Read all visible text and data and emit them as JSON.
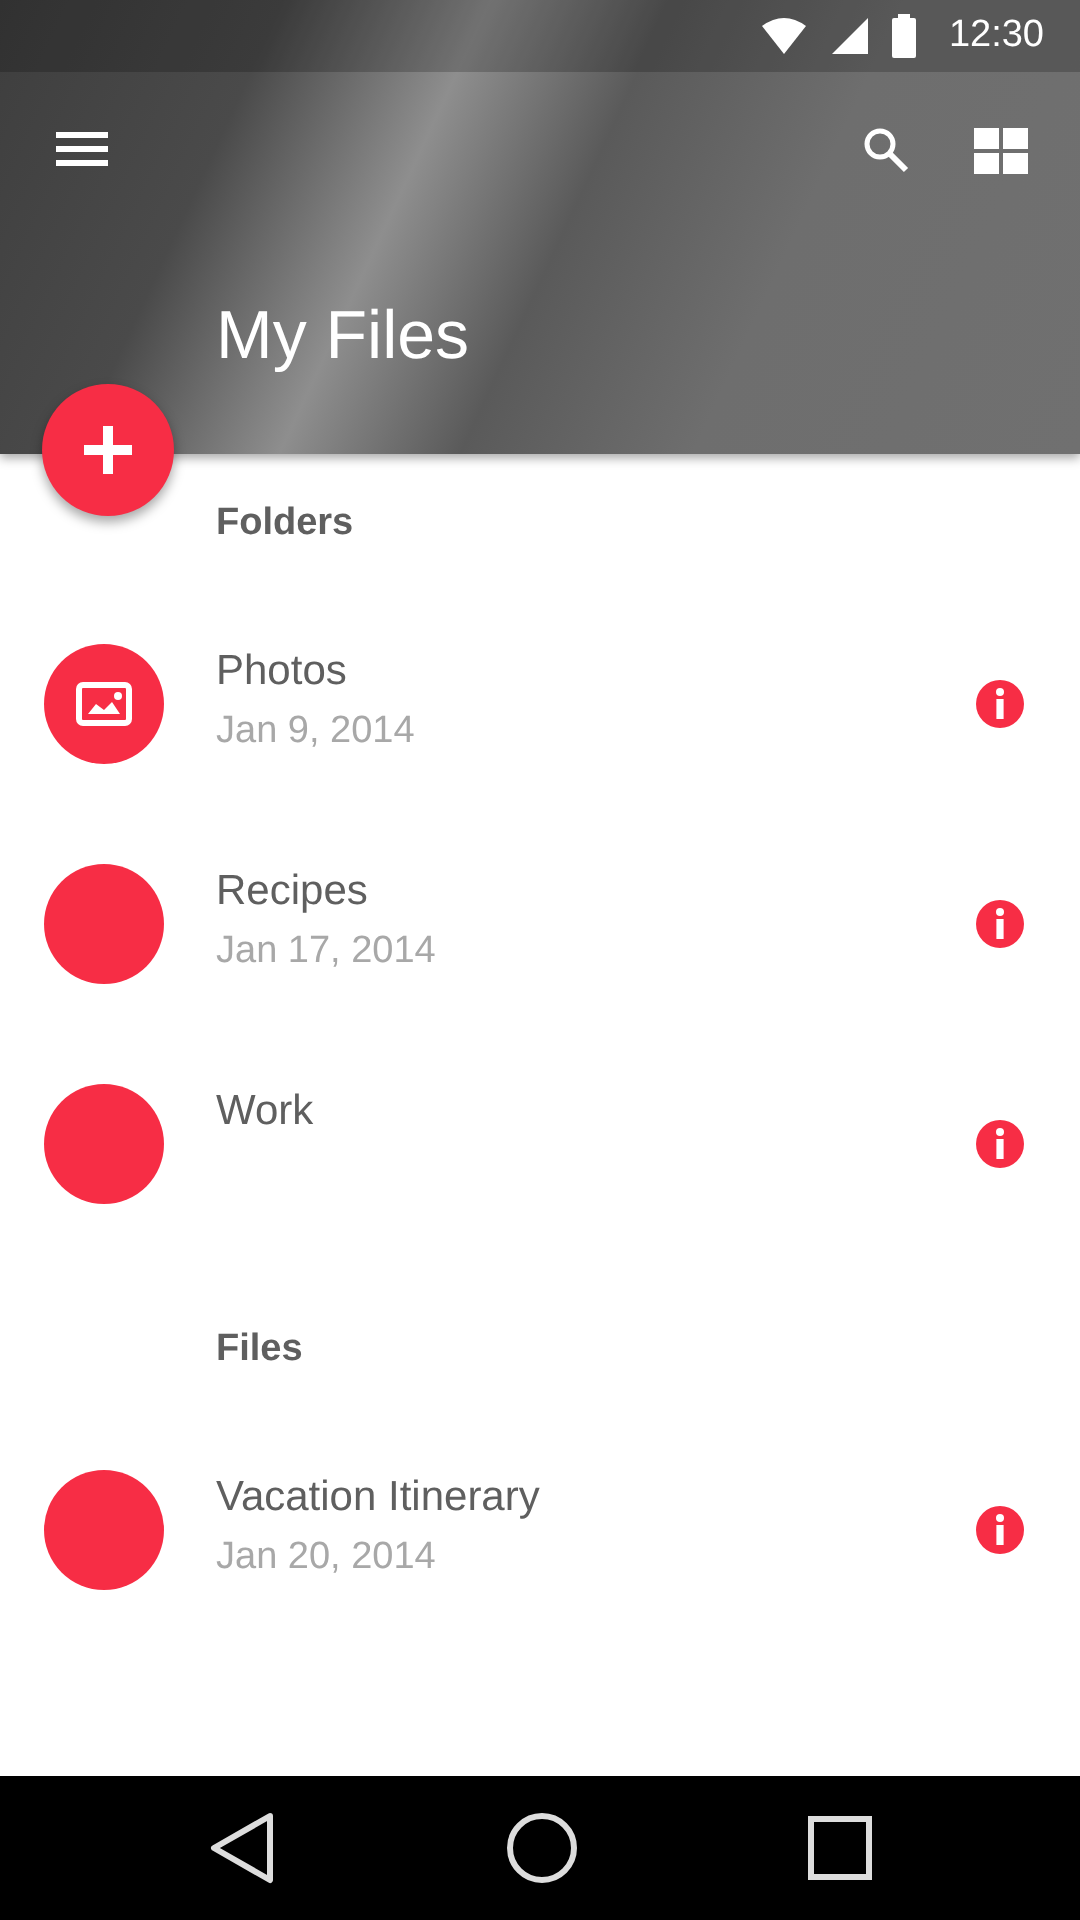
{
  "status_bar": {
    "time": "12:30"
  },
  "app_bar": {
    "title": "My Files"
  },
  "sections": [
    {
      "title": "Folders",
      "items": [
        {
          "name": "Photos",
          "date": "Jan 9, 2014",
          "kind": "image"
        },
        {
          "name": "Recipes",
          "date": "Jan 17, 2014",
          "kind": "plain"
        },
        {
          "name": "Work",
          "kind": "plain"
        }
      ]
    },
    {
      "title": "Files",
      "items": [
        {
          "name": "Vacation Itinerary",
          "date": "Jan 20, 2014",
          "kind": "plain"
        }
      ]
    }
  ]
}
